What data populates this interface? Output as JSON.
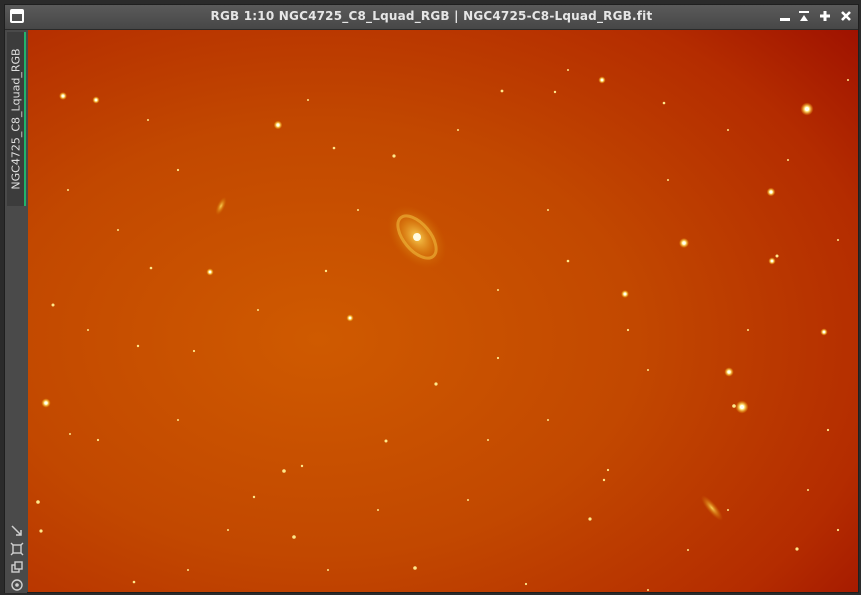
{
  "window": {
    "title": "RGB 1:10 NGC4725_C8_Lquad_RGB | NGC4725-C8-Lquad_RGB.fit",
    "controls": [
      "minimize-icon",
      "shade-icon",
      "maximize-icon",
      "close-icon"
    ]
  },
  "sidebar": {
    "tab_label": "NGC4725_C8_Lquad_RGB",
    "tools": [
      "fit-view-icon",
      "zoom-frame-icon",
      "clone-view-icon",
      "target-icon"
    ]
  },
  "image": {
    "subject": "galaxy-field",
    "colors": {
      "background_center": "#c84e00",
      "background_edge": "#a51800",
      "stars": "#fff6b0"
    }
  }
}
